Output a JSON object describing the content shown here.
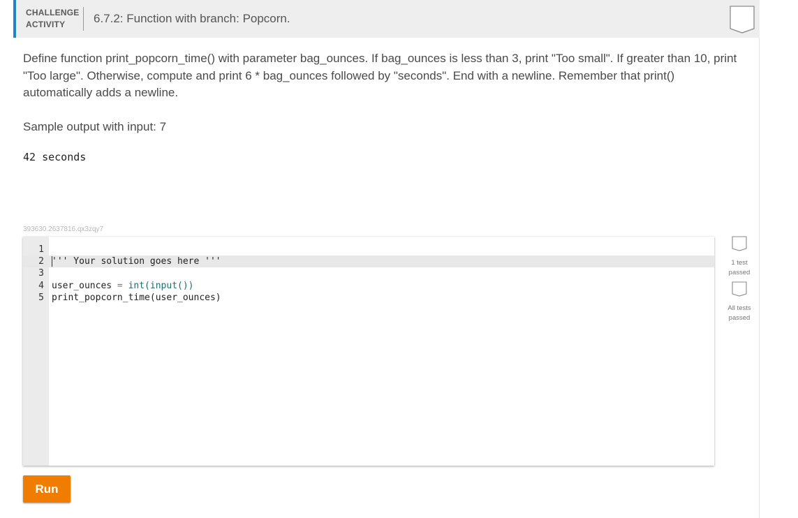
{
  "header": {
    "label_line1": "CHALLENGE",
    "label_line2": "ACTIVITY",
    "title": "6.7.2: Function with branch: Popcorn."
  },
  "prompt": {
    "text": "Define function print_popcorn_time() with parameter bag_ounces. If bag_ounces is less than 3, print \"Too small\". If greater than 10, print \"Too large\". Otherwise, compute and print 6 * bag_ounces followed by \"seconds\". End with a newline. Remember that print() automatically adds a newline.",
    "sample_label": "Sample output with input: 7",
    "sample_output": "42 seconds"
  },
  "activity_id": "393630.2637816.qx3zqy7",
  "editor": {
    "lines": [
      {
        "num": "1",
        "code": ""
      },
      {
        "num": "2",
        "code": "''' Your solution goes here '''"
      },
      {
        "num": "3",
        "code": ""
      },
      {
        "num": "4",
        "code": "user_ounces = int(input())"
      },
      {
        "num": "5",
        "code": "print_popcorn_time(user_ounces)"
      }
    ],
    "tokens": {
      "l4_var": "user_ounces",
      "l4_eq": " = ",
      "l4_fn": "int(input())",
      "l5_fn": "print_popcorn_time",
      "l5_args": "(user_ounces)"
    }
  },
  "status": {
    "one_test": "1 test passed",
    "one_test_l1": "1 test",
    "one_test_l2": "passed",
    "all_tests_l1": "All tests",
    "all_tests_l2": "passed"
  },
  "run_label": "Run",
  "colors": {
    "accent_blue": "#1e88c7",
    "run_orange": "#f07d00"
  }
}
